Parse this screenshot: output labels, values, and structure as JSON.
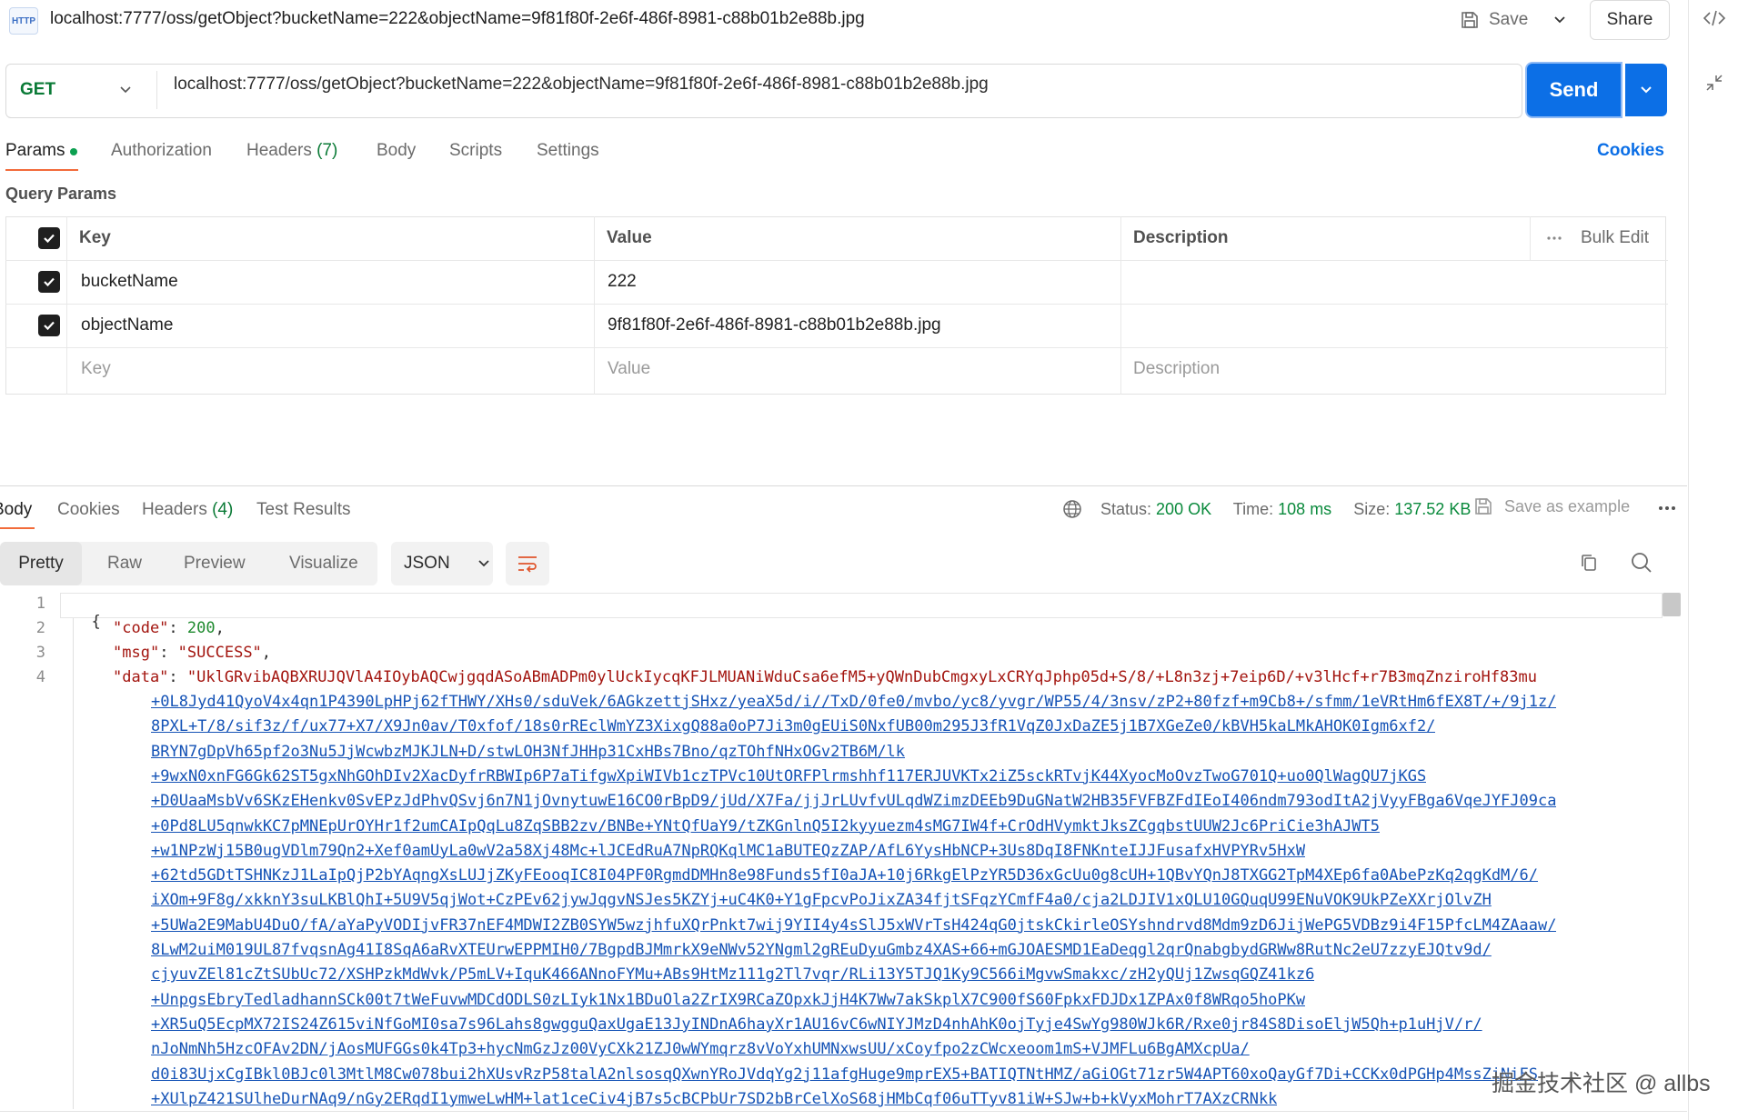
{
  "header": {
    "http_badge": "HTTP",
    "tab_title": "localhost:7777/oss/getObject?bucketName=222&objectName=9f81f80f-2e6f-486f-8981-c88b01b2e88b.jpg",
    "save_label": "Save",
    "share_label": "Share"
  },
  "request": {
    "method": "GET",
    "url": "localhost:7777/oss/getObject?bucketName=222&objectName=9f81f80f-2e6f-486f-8981-c88b01b2e88b.jpg",
    "send_label": "Send"
  },
  "request_tabs": {
    "params": "Params",
    "authorization": "Authorization",
    "headers": "Headers",
    "headers_count": "(7)",
    "body": "Body",
    "scripts": "Scripts",
    "settings": "Settings",
    "cookies": "Cookies"
  },
  "query_params": {
    "title": "Query Params",
    "columns": {
      "key": "Key",
      "value": "Value",
      "description": "Description",
      "bulk_edit": "Bulk Edit"
    },
    "rows": [
      {
        "key": "bucketName",
        "value": "222",
        "description": ""
      },
      {
        "key": "objectName",
        "value": "9f81f80f-2e6f-486f-8981-c88b01b2e88b.jpg",
        "description": ""
      }
    ],
    "placeholders": {
      "key": "Key",
      "value": "Value",
      "description": "Description"
    }
  },
  "response": {
    "tabs": {
      "body": "Body",
      "cookies": "Cookies",
      "headers": "Headers",
      "headers_count": "(4)",
      "test_results": "Test Results"
    },
    "status_label": "Status:",
    "status_value": "200 OK",
    "time_label": "Time:",
    "time_value": "108 ms",
    "size_label": "Size:",
    "size_value": "137.52 KB",
    "save_example": "Save as example",
    "views": {
      "pretty": "Pretty",
      "raw": "Raw",
      "preview": "Preview",
      "visualize": "Visualize"
    },
    "format": "JSON"
  },
  "code": {
    "line_numbers": [
      "1",
      "2",
      "3",
      "4"
    ],
    "open_brace": "{",
    "code_key": "\"code\"",
    "code_value": "200",
    "msg_key": "\"msg\"",
    "msg_value": "\"SUCCESS\"",
    "data_key": "\"data\"",
    "data_first": "\"UklGRvibAQBXRUJQVlA4IOybAQCwjgqdASoABmADPm0ylUckIycqKFJLMUANiWduCsa6efM5+yQWnDubCmgxyLxCRYqJphp05d+S/8/+L8n3zj+7eip6D/+v3lHcf+r7B3mqZnziroHf83mu",
    "data_lines": [
      "+0L8Jyd41QyoV4x4qn1P4390LpHPj62fTHWY/XHs0/sduVek/6AGkzettjSHxz/yeaX5d/i//TxD/0fe0/mvbo/yc8/yvgr/WP55/4/3nsv/zP2+80fzf+m9Cb8+/sfmm/1eVRtHm6fEX8T/+/9j1z/",
      "8PXL+T/8/sif3z/f/ux77+X7/X9Jn0av/T0xfof/18s0rREclWmYZ3XixgQ88a0oP7Ji3m0gEUiS0NxfUB00m295J3fR1VqZ0JxDaZE5j1B7XGeZe0/kBVH5kaLMkAHOK0Igm6xf2/",
      "BRYN7gDpVh65pf2o3Nu5JjWcwbzMJKJLN+D/stwLOH3NfJHHp31CxHBs7Bno/qzTOhfNHxOGv2TB6M/lk",
      "+9wxN0xnFG6Gk62ST5gxNhGOhDIv2XacDyfrRBWIp6P7aTifgwXpiWIVb1czTPVc10UtORFPlrmshhf117ERJUVKTx2iZ5sckRTvjK44XyocMoOvzTwoG701Q+uo0QlWagQU7jKGS",
      "+D0UaaMsbVv6SKzEHenkv0SvEPzJdPhvQSvj6n7N1jOvnytuwE16CO0rBpD9/jUd/X7Fa/jjJrLUvfvULqdWZimzDEEb9DuGNatW2HB35FVFBZFdIEoI406ndm793odItA2jVyyFBga6VqeJYFJ09ca",
      "+0Pd8LU5qnwkKC7pMNEpUrOYHr1f2umCAIpQqLu8ZqSBB2zv/BNBe+YNtQfUaY9/tZKGnlnQ5I2kyyuezm4sMG7IW4f+CrOdHVymktJksZCgqbstUUW2Jc6PriCie3hAJWT5",
      "+w1NPzWj15B0ugVDlm79Qn2+Xef0amUyLa0wV2a58Xj48Mc+lJCEdRuA7NpRQKqlMC1aBUTEQzZAP/AfL6YysHbNCP+3Us8DqI8FNKnteIJJFusafxHVPYRv5HxW",
      "+62td5GDtTSHNKzJ1LaIpQjP2bYAqngXsLUJjZKyFEooqIC8I04PF0RgmdDMHn8e98Funds5fI0aJA+10j6RkgElPzYR5D36xGcUu0g8cUH+1QBvYQnJ8TXGG2TpM4XEp6fa0AbePzKq2qgKdM/6/",
      "iXOm+9F8g/xkknY3suLKBlQhI+5U9V5qjWot+CzPEv62jywJqgvNSJes5KZYj+uC4K0+Y1gFpcvPoJixZA34fjtSFqzYCmfF4a0/cja2LDJIV1xQLU10GQuqU99ENuVOK9UkPZeXXrjOlvZH",
      "+5UWa2E9MabU4DuO/fA/aYaPyVODIjvFR37nEF4MDWI2ZB0SYW5wzjhfuXQrPnkt7wij9YII4y4sSlJ5xWVrTsH424qG0jtskCkirleOSYshndrvd8Mdm9zD6JijWePG5VDBz9i4F15PfcLM4ZAaaw/",
      "8LwM2uiM019UL87fvqsnAg41I8SqA6aRvXTEUrwEPPMIH0/7BgpdBJMmrkX9eNWv52YNgml2gREuDyuGmbz4XAS+66+mGJOAESMD1EaDeqgl2qrQnabgbydGRWw8RutNc2eU7zzyEJQtv9d/",
      "cjyuvZEl81cZtSUbUc72/XSHPzkMdWvk/P5mLV+IquK466ANnoFYMu+ABs9HtMz111g2Tl7vqr/RLi13Y5TJQ1Ky9C566iMgvwSmakxc/zH2yQUj1ZwsqGQZ41kz6",
      "+UnpgsEbryTedladhannSCk00t7tWeFuvwMDCdODLS0zLIyk1Nx1BDuOla2ZrIX9RCaZOpxkJjH4K7Ww7akSkplX7C900fS60FpkxFDJDx1ZPAx0f8WRqo5hoPKw",
      "+XR5uQ5EcpMX72IS24Z615viNfGoMI0sa7s96Lahs8gwgguQaxUgaE13JyINDnA6hayXr1AU16vC6wNIYJMzD4nhAhK0ojTyje4SwYg980WJk6R/Rxe0jr84S8DisoEljW5Qh+p1uHjV/r/",
      "nJoNmNh5HzcOFAv2DN/jAosMUFGGs0k4Tp3+hycNmGzJz00VyCXk21ZJ0wWYmqrz8vVoYxhUMNxwsUU/xCoyfpo2zCWcxeoom1mS+VJMFLu6BgAMXcpUa/",
      "d0i83UjxCgIBkl0BJc0l3MtlM8Cw078bui2hXUsvRzP58talA2nlsosqQXwnYRoJVdqYg2j11afgHuge9mprEX5+BATIQTNtHMZ/aGiOGt71zr5W4APT60xoQayGf7Di+CCKx0dPGHp4MssZiNiFS",
      "+XUlpZ421SUlheDurNAq9/nGy2ERqdI1ymweLwHM+lat1ceCiv4jB7s5cBCPbUr7SD2bBrCelXoS68jHMbCqf06uTTyv81iW+SJw+b+kVyxMohrT7AXzCRNkk"
    ]
  },
  "watermark": "掘金技术社区 @ allbs"
}
